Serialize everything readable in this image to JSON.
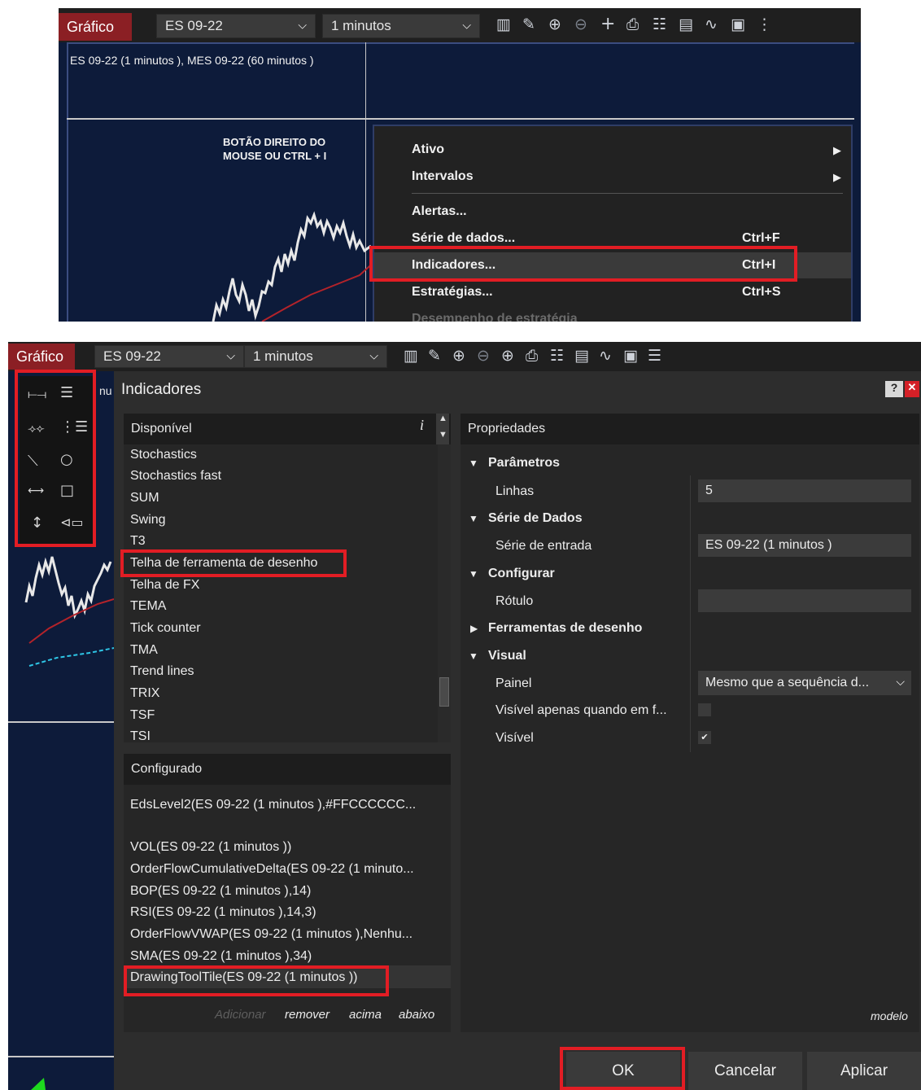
{
  "top": {
    "toolbar": {
      "tab_label": "Gráfico",
      "instrument": "ES 09-22",
      "interval": "1 minutos",
      "dropdown_arrow": "❯"
    },
    "chart_title": "ES 09-22 (1 minutos ), MES 09-22 (60 minutos )",
    "annotation_line1": "BOTÃO DIREITO DO",
    "annotation_line2": "MOUSE OU CTRL + I",
    "context_menu": [
      {
        "label": "Ativo",
        "shortcut": "",
        "submenu": true
      },
      {
        "label": "Intervalos",
        "shortcut": "",
        "submenu": true
      },
      {
        "label": "Alertas...",
        "shortcut": ""
      },
      {
        "label": "Série de dados...",
        "shortcut": "Ctrl+F"
      },
      {
        "label": "Indicadores...",
        "shortcut": "Ctrl+I",
        "highlighted": true
      },
      {
        "label": "Estratégias...",
        "shortcut": "Ctrl+S"
      },
      {
        "label": "Desempenho de estratégia",
        "shortcut": "",
        "disabled": true
      }
    ]
  },
  "bottom": {
    "toolbar": {
      "tab_label": "Gráfico",
      "instrument": "ES 09-22",
      "interval": "1 minutos"
    },
    "chart_partial_text": "nu",
    "dialog": {
      "title": "Indicadores",
      "help": "?",
      "close": "✕",
      "available": {
        "header": "Disponível",
        "info": "i",
        "items": [
          "Stochastics",
          "Stochastics fast",
          "SUM",
          "Swing",
          "T3",
          "Telha de ferramenta de desenho",
          "Telha de FX",
          "TEMA",
          "Tick counter",
          "TMA",
          "Trend lines",
          "TRIX",
          "TSF",
          "TSI"
        ]
      },
      "configured": {
        "header": "Configurado",
        "items": [
          "EdsLevel2(ES 09-22 (1 minutos ),#FFCCCCCC...",
          "",
          "VOL(ES 09-22 (1 minutos ))",
          "OrderFlowCumulativeDelta(ES 09-22 (1 minuto...",
          "BOP(ES 09-22 (1 minutos ),14)",
          "RSI(ES 09-22 (1 minutos ),14,3)",
          "OrderFlowVWAP(ES 09-22 (1 minutos ),Nenhu...",
          "SMA(ES 09-22 (1 minutos ),34)",
          "DrawingToolTile(ES 09-22 (1 minutos ))"
        ],
        "actions": {
          "add": "Adicionar",
          "remove": "remover",
          "up": "acima",
          "down": "abaixo"
        }
      },
      "properties": {
        "header": "Propriedades",
        "parametros": "Parâmetros",
        "linhas_label": "Linhas",
        "linhas_value": "5",
        "serie_dados": "Série de Dados",
        "serie_entrada_label": "Série de entrada",
        "serie_entrada_value": "ES 09-22 (1 minutos )",
        "configurar": "Configurar",
        "rotulo_label": "Rótulo",
        "rotulo_value": "",
        "ferramentas": "Ferramentas de desenho",
        "visual": "Visual",
        "painel_label": "Painel",
        "painel_value": "Mesmo que a sequência d...",
        "visivel_foco_label": "Visível apenas quando em f...",
        "visivel_foco_checked": false,
        "visivel_label": "Visível",
        "visivel_checked": true,
        "check_mark": "✔",
        "template_link": "modelo"
      },
      "buttons": {
        "ok": "OK",
        "cancel": "Cancelar",
        "apply": "Aplicar"
      }
    }
  },
  "colors": {
    "highlight_box": "#e21d24",
    "tab_red": "#8b1f24",
    "chart_bg": "#0d1b3a",
    "dialog_bg": "#2d2d2d"
  }
}
